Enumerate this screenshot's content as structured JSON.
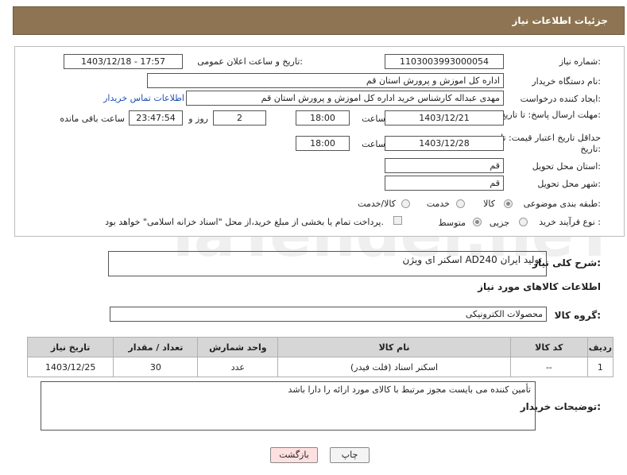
{
  "header": {
    "title": "جزئیات اطلاعات نیاز"
  },
  "fields": {
    "need_number_label": "شماره نیاز:",
    "need_number": "1103003993000054",
    "announce_label": "تاریخ و ساعت اعلان عمومی:",
    "announce_value": "1403/12/18 - 17:57",
    "buyer_org_label": "نام دستگاه خریدار:",
    "buyer_org": "اداره کل اموزش و پرورش استان قم",
    "requester_label": "ایجاد کننده درخواست:",
    "requester": "مهدی عبداله کارشناس خرید اداره کل اموزش و پرورش استان قم",
    "contact_link": "اطلاعات تماس خریدار",
    "reply_deadline_label": "مهلت ارسال پاسخ: تا تاریخ:",
    "reply_date": "1403/12/21",
    "time_label": "ساعت",
    "reply_time": "18:00",
    "days_value": "2",
    "days_label": "روز و",
    "remaining_value": "23:47:54",
    "remaining_label": "ساعت باقی مانده",
    "price_validity_label": "حداقل تاریخ اعتبار قیمت: تا تاریخ:",
    "price_date": "1403/12/28",
    "price_time": "18:00",
    "province_label": "استان محل تحویل:",
    "province": "قم",
    "city_label": "شهر محل تحویل:",
    "city": "قم",
    "category_label": "طبقه بندی موضوعی:",
    "category_options": [
      "کالا",
      "خدمت",
      "کالا/خدمت"
    ],
    "process_label": "نوع فرآیند خرید :",
    "process_options": [
      "جزیی",
      "متوسط"
    ],
    "payment_note": "پرداخت تمام یا بخشی از مبلغ خرید،از محل \"اسناد خزانه اسلامی\" خواهد بود."
  },
  "description": {
    "label": "شرح کلی نیاز:",
    "value": "اسکنر ای ویژن AD240 تولید ایران"
  },
  "goods_section": {
    "title": "اطلاعات کالاهای مورد نیاز",
    "group_label": "گروه کالا:",
    "group_value": "محصولات الکترونیکی"
  },
  "table": {
    "headers": [
      "ردیف",
      "کد کالا",
      "نام کالا",
      "واحد شمارش",
      "تعداد / مقدار",
      "تاریخ نیاز"
    ],
    "rows": [
      [
        "1",
        "--",
        "اسکنر اسناد (فلت فیدر)",
        "عدد",
        "30",
        "1403/12/25"
      ]
    ]
  },
  "buyer_notes": {
    "label": "توضیحات خریدار:",
    "value": "تأمین کننده می بایست مجوز مرتبط با کالای مورد ارائه را دارا باشد"
  },
  "buttons": {
    "print": "چاپ",
    "back": "بازگشت"
  },
  "watermark": {
    "text": "AriaTender.neT"
  },
  "colors": {
    "header_bg": "#8e7452",
    "link": "#1f4fb5",
    "back_button_bg": "#ffe0e0"
  }
}
